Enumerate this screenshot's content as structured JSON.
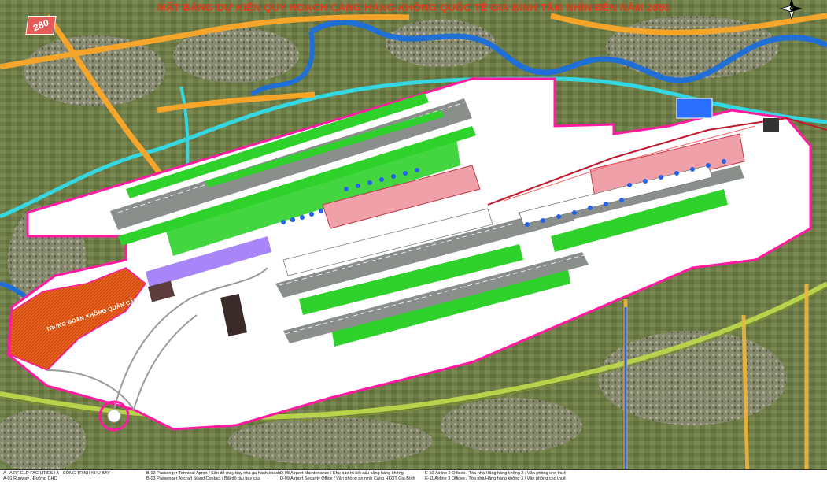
{
  "title": "MẶT BẰNG DỰ KIẾN QUY HOẠCH CẢNG HÀNG KHÔNG QUỐC TẾ GIA BÌNH TẦM NHÌN ĐẾN NĂM 2050",
  "road_badge": "280",
  "area_label": "TRUNG ĐOÀN KHÔNG QUÂN CẢNG",
  "colors": {
    "boundary": "#ff1aa0",
    "runway": "#8a8f8c",
    "grass": "#2fd12b",
    "terminal": "#f0a0a8",
    "apron": "#ffffff",
    "river": "#1f6fd6",
    "canal": "#35d8e0",
    "road_orange": "#f5a52a",
    "rail": "#b8d34a",
    "military": "#e8601e"
  },
  "legend": {
    "section_a": "A - AIRFIELD FACILITIES / A - CÔNG TRÌNH KHU BAY",
    "a01": "A-01    Runway / Đường CHC",
    "b02": "B-02    Passenger Terminal Apron / Sân đỗ máy bay nhà ga hành khách",
    "b03": "B-03    Passenger Aircraft Stand Contact / Bãi đỗ tàu bay cầu",
    "d08": "D-08    Airport Maintenance / Khu bảo trì kết cấu cảng hàng không",
    "d09": "D-09    Airport Security Office / Văn phòng an ninh Cảng HKQT Gia Bình",
    "e10": "E-10    Airline 2 Offices / Tòa nhà Hãng hàng không 2 / Văn phòng cho thuê",
    "e11": "E-11    Airline 3 Offices / Tòa nhà Hãng hàng không 3 / Văn phòng cho thuê"
  }
}
